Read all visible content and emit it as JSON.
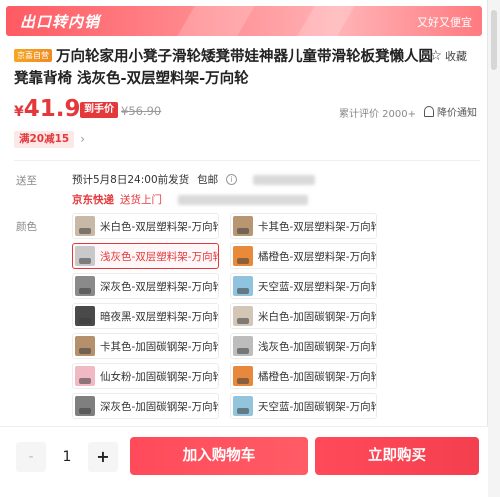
{
  "banner": {
    "title": "出口转内销",
    "slogan": "又好又便宜"
  },
  "product": {
    "badge": "京喜自营",
    "title": "万向轮家用小凳子滑轮矮凳带娃神器儿童带滑轮板凳懒人圆凳靠背椅 浅灰色-双层塑料架-万向轮",
    "favorite_label": "收藏"
  },
  "price": {
    "currency": "¥",
    "current": "41.9",
    "arrival_tag": "到手价",
    "original": "¥56.90",
    "reviews": "累计评价 2000+",
    "notify_label": "降价通知"
  },
  "coupon": {
    "label": "满20减15"
  },
  "delivery": {
    "label": "送至",
    "ship_text": "预计5月8日24:00前发货",
    "free_ship": "包邮",
    "info_icon": "i",
    "carrier": "京东快递",
    "door": "送货上门"
  },
  "variant_label": "颜色",
  "variants": [
    {
      "name": "米白色-双层塑料架-万向轮",
      "color": "#c8b8a6",
      "selected": false
    },
    {
      "name": "卡其色-双层塑料架-万向轮",
      "color": "#b89672",
      "selected": false
    },
    {
      "name": "浅灰色-双层塑料架-万向轮",
      "color": "#c9c9c9",
      "selected": true
    },
    {
      "name": "橘橙色-双层塑料架-万向轮",
      "color": "#e98a3a",
      "selected": false
    },
    {
      "name": "深灰色-双层塑料架-万向轮",
      "color": "#8a8a8a",
      "selected": false
    },
    {
      "name": "天空蓝-双层塑料架-万向轮",
      "color": "#8fc3de",
      "selected": false
    },
    {
      "name": "暗夜黑-双层塑料架-万向轮",
      "color": "#4a4a4a",
      "selected": false
    },
    {
      "name": "米白色-加固碳钢架-万向轮",
      "color": "#d3c6b6",
      "selected": false
    },
    {
      "name": "卡其色-加固碳钢架-万向轮",
      "color": "#b4906c",
      "selected": false
    },
    {
      "name": "浅灰色-加固碳钢架-万向轮",
      "color": "#bdbdbd",
      "selected": false
    },
    {
      "name": "仙女粉-加固碳钢架-万向轮",
      "color": "#f0b9c4",
      "selected": false
    },
    {
      "name": "橘橙色-加固碳钢架-万向轮",
      "color": "#e7883c",
      "selected": false
    },
    {
      "name": "深灰色-加固碳钢架-万向轮",
      "color": "#7f7f7f",
      "selected": false
    },
    {
      "name": "天空蓝-加固碳钢架-万向轮",
      "color": "#92c4dc",
      "selected": false
    }
  ],
  "quantity": {
    "minus": "-",
    "value": "1",
    "plus": "+"
  },
  "actions": {
    "add_to_cart": "加入购物车",
    "buy_now": "立即购买"
  },
  "colors": {
    "accent": "#e4393c"
  }
}
